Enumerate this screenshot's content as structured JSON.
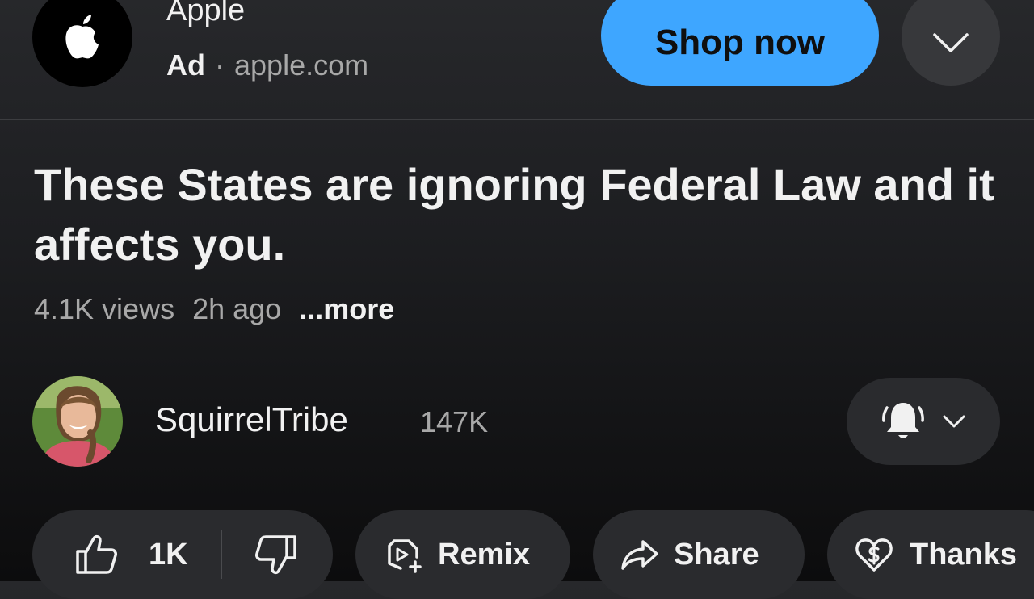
{
  "ad": {
    "advertiser": "Apple",
    "tag": "Ad",
    "separator": "·",
    "domain": "apple.com",
    "cta": "Shop now",
    "cta_color": "#3ea6ff"
  },
  "video": {
    "title": "These States are ignoring Federal Law and it affects you.",
    "views": "4.1K views",
    "age": "2h ago",
    "more": "...more"
  },
  "channel": {
    "name": "SquirrelTribe",
    "subscribers": "147K",
    "notification_icon": "bell-icon"
  },
  "actions": {
    "likes": "1K",
    "remix": "Remix",
    "share": "Share",
    "thanks": "Thanks"
  }
}
